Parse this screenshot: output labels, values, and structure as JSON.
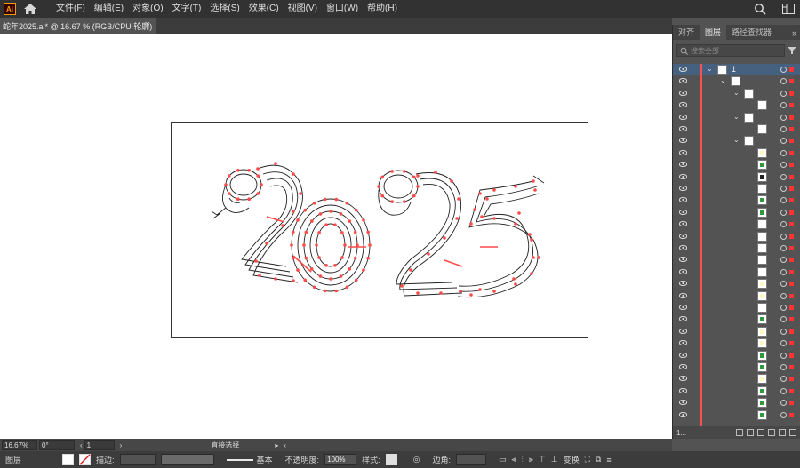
{
  "app": {
    "logo_text": "Ai",
    "menu": [
      "文件(F)",
      "编辑(E)",
      "对象(O)",
      "文字(T)",
      "选择(S)",
      "效果(C)",
      "视图(V)",
      "窗口(W)",
      "帮助(H)"
    ]
  },
  "document_tab": {
    "title": "蛇年2025.ai* @ 16.67 % (RGB/CPU 轮廓)",
    "close": "×"
  },
  "panel": {
    "tabs": [
      "对齐",
      "图层",
      "路径查找器"
    ],
    "active_tab": "图层",
    "collapse": "»",
    "search_placeholder": "搜索全部",
    "footer_count": "1...",
    "layer_rows": [
      {
        "name": "1",
        "expanded": true,
        "level": 0,
        "selected": true
      },
      {
        "name": "...",
        "expanded": true,
        "level": 1
      },
      {
        "name": "",
        "expanded": true,
        "level": 2
      },
      {
        "name": "",
        "level": 3
      },
      {
        "name": "",
        "expanded": true,
        "level": 2
      },
      {
        "name": "",
        "level": 3
      },
      {
        "name": "",
        "expanded": true,
        "level": 2
      },
      {
        "name": "",
        "level": 3,
        "thumb": "yellow"
      },
      {
        "name": "",
        "level": 3,
        "thumb": "green"
      },
      {
        "name": "",
        "level": 3,
        "thumb": "black"
      },
      {
        "name": "",
        "level": 3,
        "thumb": "white"
      },
      {
        "name": "",
        "level": 3,
        "thumb": "green"
      },
      {
        "name": "",
        "level": 3,
        "thumb": "green"
      },
      {
        "name": "",
        "level": 3,
        "thumb": "white"
      },
      {
        "name": "",
        "level": 3,
        "thumb": "white"
      },
      {
        "name": "",
        "level": 3,
        "thumb": "white"
      },
      {
        "name": "",
        "level": 3,
        "thumb": "white"
      },
      {
        "name": "",
        "level": 3,
        "thumb": "white"
      },
      {
        "name": "",
        "level": 3,
        "thumb": "yellow"
      },
      {
        "name": "",
        "level": 3,
        "thumb": "yellow"
      },
      {
        "name": "",
        "level": 3,
        "thumb": "white"
      },
      {
        "name": "",
        "level": 3,
        "thumb": "green"
      },
      {
        "name": "",
        "level": 3,
        "thumb": "yellow"
      },
      {
        "name": "",
        "level": 3,
        "thumb": "yellow"
      },
      {
        "name": "",
        "level": 3,
        "thumb": "green"
      },
      {
        "name": "",
        "level": 3,
        "thumb": "green"
      },
      {
        "name": "",
        "level": 3,
        "thumb": "yellow"
      },
      {
        "name": "",
        "level": 3,
        "thumb": "green"
      },
      {
        "name": "",
        "level": 3,
        "thumb": "green"
      },
      {
        "name": "",
        "level": 3,
        "thumb": "green"
      }
    ]
  },
  "status": {
    "zoom": "16.67%",
    "rotation": "0°",
    "artboard_nav": "1",
    "tool": "直接选择"
  },
  "control": {
    "object_type": "图层",
    "stroke_label": "描边:",
    "stroke_profile": "基本",
    "opacity_label": "不透明度:",
    "opacity_value": "100%",
    "style_label": "样式:",
    "corner_label": "边角:",
    "transform_label": "变换"
  },
  "colors": {
    "selection_red": "#ff4a4a",
    "layer_selected": "#46607f",
    "accent_logo": "#ff9a00"
  }
}
